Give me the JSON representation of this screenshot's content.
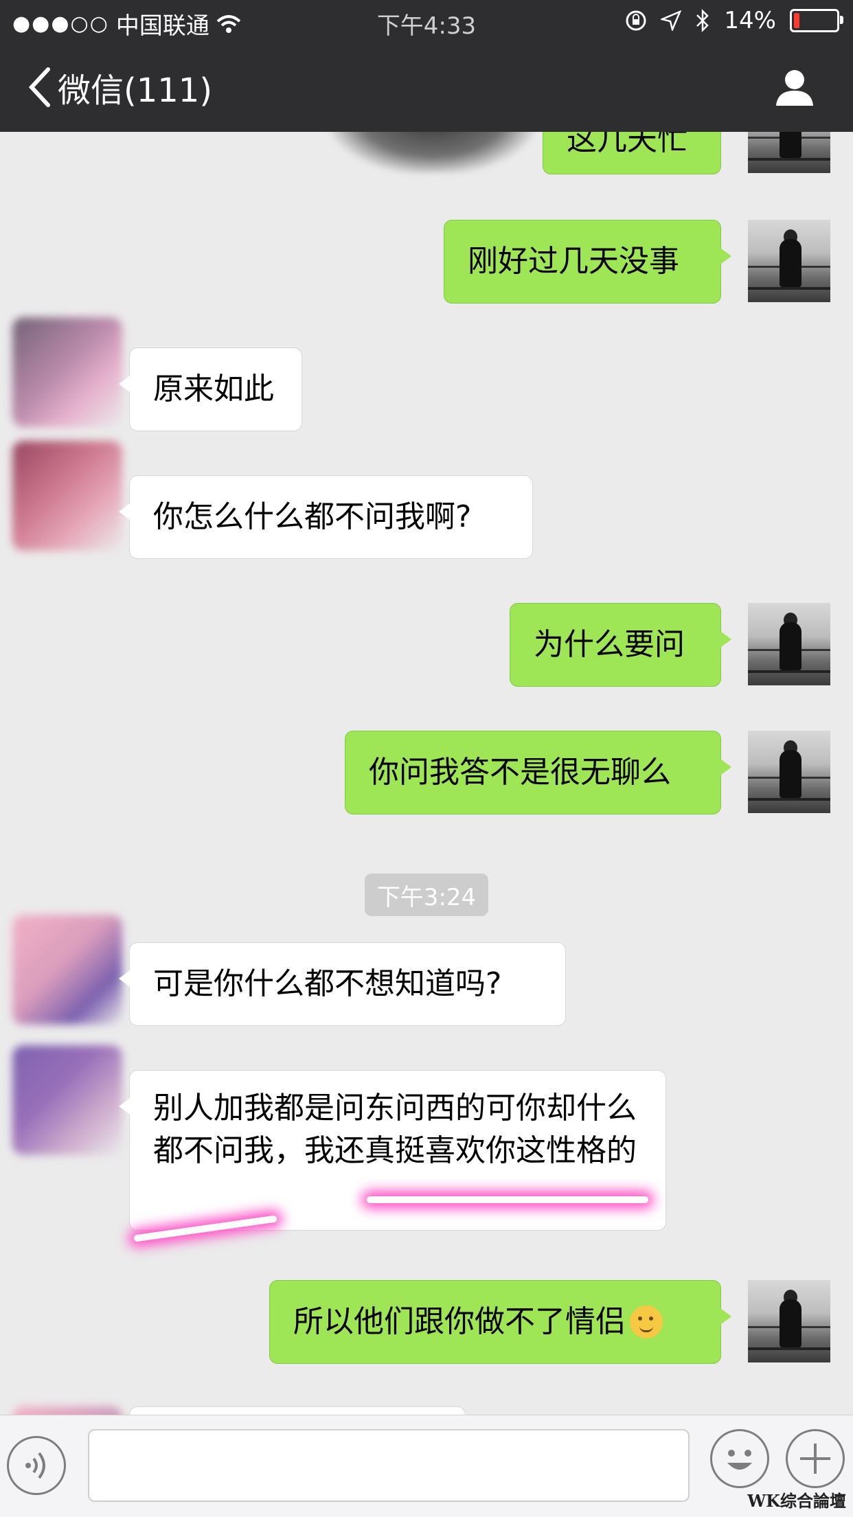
{
  "status_bar": {
    "signal": "●●●○○",
    "carrier": "中国联通",
    "time": "下午4:33",
    "battery_percent": "14%",
    "battery_level": 0.14,
    "battery_color": "#ff3b30"
  },
  "nav": {
    "back_label": "微信(111)"
  },
  "messages": [
    {
      "side": "out",
      "text": "这几天忙"
    },
    {
      "side": "out",
      "text": "刚好过几天没事"
    },
    {
      "side": "in",
      "text": "原来如此"
    },
    {
      "side": "in",
      "text": "你怎么什么都不问我啊?"
    },
    {
      "side": "out",
      "text": "为什么要问"
    },
    {
      "side": "out",
      "text": "你问我答不是很无聊么"
    },
    {
      "side": "in",
      "text": "可是你什么都不想知道吗?"
    },
    {
      "side": "in",
      "text": "别人加我都是问东问西的可你却什么都不问我，我还真挺喜欢你这性格的"
    },
    {
      "side": "out",
      "text": "所以他们跟你做不了情侣",
      "emoji": "thinking-face-icon"
    }
  ],
  "timestamp": "下午3:24",
  "colors": {
    "outgoing_bubble": "#9fe657",
    "incoming_bubble": "#ffffff",
    "nav_background": "#2e2e31",
    "chat_background": "#ebebeb",
    "highlight": "#ff4fc7"
  },
  "input": {
    "value": ""
  },
  "watermark": "WK综合論壇"
}
